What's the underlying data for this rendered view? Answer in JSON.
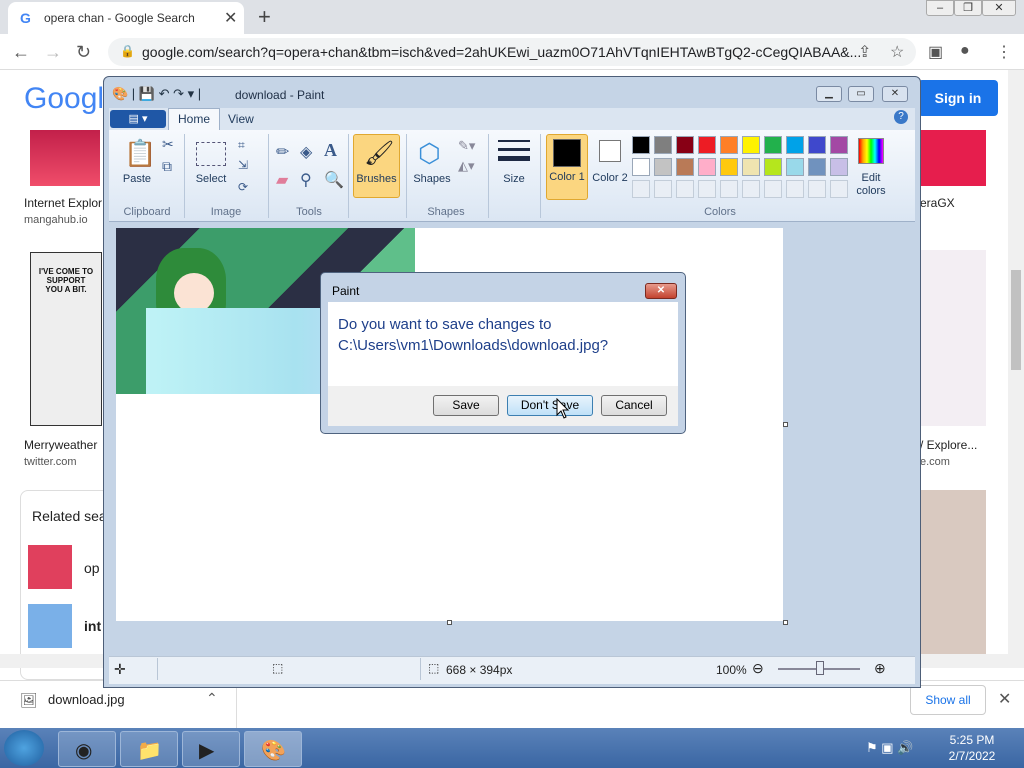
{
  "browser": {
    "tab_title": "opera chan - Google Search",
    "tab_favicon": "G",
    "url": "google.com/search?q=opera+chan&tbm=isch&ved=2ahUKEwi_uazm0O71AhVTqnIEHTAwBTgQ2-cCegQIABAA&..."
  },
  "google": {
    "logo": "Googl",
    "sign_in": "Sign in",
    "results": [
      {
        "title": "Internet Explor",
        "source": "mangahub.io"
      },
      {
        "title": "Merryweather",
        "source": "twitter.com"
      },
      {
        "title": "eraGX",
        "source": ""
      },
      {
        "title": "/ Explore...",
        "source": "e.com"
      }
    ],
    "comic_text": "I'VE COME TO SUPPORT YOU A BIT.",
    "related_title": "Related sea",
    "related_items": [
      "op",
      "int"
    ]
  },
  "download_bar": {
    "file": "download.jpg",
    "show_all": "Show all"
  },
  "taskbar": {
    "time": "5:25 PM",
    "date": "2/7/2022"
  },
  "paint": {
    "title": "download - Paint",
    "tabs": {
      "file": "",
      "home": "Home",
      "view": "View"
    },
    "groups": {
      "clipboard": "Clipboard",
      "image": "Image",
      "tools": "Tools",
      "shapes": "Shapes",
      "colors": "Colors"
    },
    "buttons": {
      "paste": "Paste",
      "select": "Select",
      "brushes": "Brushes",
      "shapes": "Shapes",
      "size": "Size",
      "color1": "Color 1",
      "color2": "Color 2",
      "edit_colors": "Edit colors"
    },
    "palette_row1": [
      "#000000",
      "#7f7f7f",
      "#880015",
      "#ed1c24",
      "#ff7f27",
      "#fff200",
      "#22b14c",
      "#00a2e8",
      "#3f48cc",
      "#a349a4"
    ],
    "palette_row2": [
      "#ffffff",
      "#c3c3c3",
      "#b97a57",
      "#ffaec9",
      "#ffc90e",
      "#efe4b0",
      "#b5e61d",
      "#99d9ea",
      "#7092be",
      "#c8bfe7"
    ],
    "status": {
      "dimensions": "668 × 394px",
      "zoom": "100%"
    }
  },
  "dialog": {
    "title": "Paint",
    "message_line1": "Do you want to save changes to",
    "message_line2": "C:\\Users\\vm1\\Downloads\\download.jpg?",
    "save": "Save",
    "dont_save": "Don't Save",
    "cancel": "Cancel"
  }
}
